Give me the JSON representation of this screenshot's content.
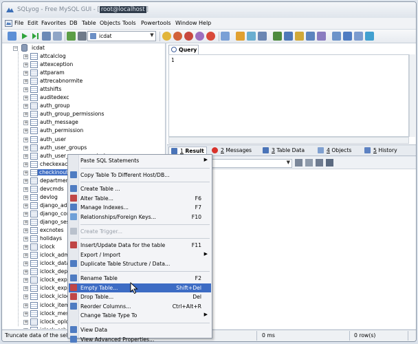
{
  "window": {
    "title_prefix": "SQLyog - Free MySQL GUI - [",
    "title_user": "root@localhost",
    "title_suffix": "]"
  },
  "menu": [
    "File",
    "Edit",
    "Favorites",
    "DB",
    "Table",
    "Objects",
    "Tools",
    "Powertools",
    "Window",
    "Help"
  ],
  "toolbar": {
    "db_selector_value": "icdat"
  },
  "tree": {
    "database": "icdat",
    "tables": [
      "attcalclog",
      "attexception",
      "attparam",
      "attrecabnormite",
      "attshifts",
      "auditedexc",
      "auth_group",
      "auth_group_permissions",
      "auth_message",
      "auth_permission",
      "auth_user",
      "auth_user_groups",
      "auth_user_user_permissions",
      "checkexact",
      "checkinout",
      "departments",
      "devcmds",
      "devlog",
      "django_adm",
      "django_cont",
      "django_sess",
      "excnotes",
      "holidays",
      "iclock",
      "iclock_admi",
      "iclock_datan",
      "iclock_depta",
      "iclock_expor",
      "iclock_expor",
      "iclock_iclock",
      "iclock_itemc",
      "iclock_messa",
      "iclock_oplog",
      "iclock_sche"
    ],
    "selected_index": 14
  },
  "query": {
    "tab_label": "Query",
    "line_number": "1"
  },
  "result_tabs": [
    {
      "num": "1",
      "label": "Result",
      "color": "#4a74b8"
    },
    {
      "num": "2",
      "label": "Messages",
      "color": "#d8322b"
    },
    {
      "num": "3",
      "label": "Table Data",
      "color": "#4a74b8"
    },
    {
      "num": "4",
      "label": "Objects",
      "color": "#4a74b8"
    },
    {
      "num": "5",
      "label": "History",
      "color": "#4a74b8"
    }
  ],
  "status": {
    "message": "Truncate data of the sel",
    "time": "0 ms",
    "rows": "0 row(s)"
  },
  "context_menu": [
    {
      "label": "Paste SQL Statements",
      "shortcut": "",
      "submenu": true,
      "icon": ""
    },
    {
      "sep": true
    },
    {
      "label": "Copy Table To Different Host/DB...",
      "shortcut": "",
      "icon": "#4f7cc2"
    },
    {
      "sep": true
    },
    {
      "label": "Create Table ...",
      "shortcut": "",
      "icon": "#4f7cc2"
    },
    {
      "label": "Alter Table...",
      "shortcut": "F6",
      "icon": "#c04646"
    },
    {
      "label": "Manage Indexes...",
      "shortcut": "F7",
      "icon": "#4f7cc2"
    },
    {
      "label": "Relationships/Foreign Keys...",
      "shortcut": "F10",
      "icon": "#6fa0d8"
    },
    {
      "sep": true
    },
    {
      "label": "Create Trigger...",
      "shortcut": "",
      "icon": "#b9c1cc",
      "disabled": true
    },
    {
      "sep": true
    },
    {
      "label": "Insert/Update Data for the table",
      "shortcut": "F11",
      "icon": "#c04646"
    },
    {
      "label": "Export / Import",
      "shortcut": "",
      "submenu": true,
      "icon": ""
    },
    {
      "label": "Duplicate Table Structure / Data...",
      "shortcut": "",
      "icon": "#4f7cc2"
    },
    {
      "sep": true
    },
    {
      "label": "Rename Table",
      "shortcut": "F2",
      "icon": "#4f7cc2"
    },
    {
      "label": "Empty Table...",
      "shortcut": "Shift+Del",
      "icon": "#c04646",
      "highlight": true
    },
    {
      "label": "Drop Table...",
      "shortcut": "Del",
      "icon": "#c04646"
    },
    {
      "label": "Reorder Columns...",
      "shortcut": "Ctrl+Alt+R",
      "icon": "#4f7cc2"
    },
    {
      "label": "Change Table Type To",
      "shortcut": "",
      "submenu": true,
      "icon": ""
    },
    {
      "sep": true
    },
    {
      "label": "View Data",
      "shortcut": "",
      "icon": "#4f7cc2"
    },
    {
      "label": "View Advanced Properties...",
      "shortcut": "",
      "icon": "#4f7cc2"
    }
  ]
}
